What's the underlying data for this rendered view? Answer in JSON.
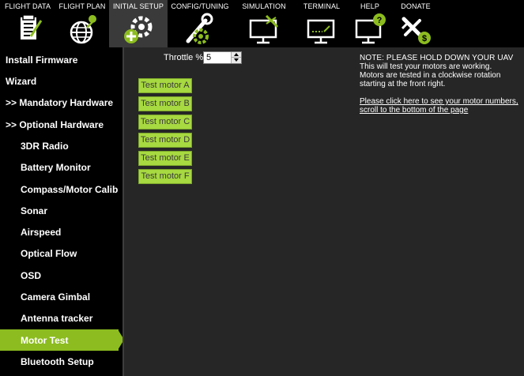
{
  "topnav": {
    "items": [
      {
        "label": "FLIGHT DATA",
        "icon": "clipboard-icon",
        "active": false
      },
      {
        "label": "FLIGHT PLAN",
        "icon": "globe-icon",
        "active": false
      },
      {
        "label": "INITIAL SETUP",
        "icon": "gear-plus-icon",
        "active": true
      },
      {
        "label": "CONFIG/TUNING",
        "icon": "wrench-gear-icon",
        "active": false
      },
      {
        "label": "SIMULATION",
        "icon": "monitor-plane-icon",
        "active": false
      },
      {
        "label": "TERMINAL",
        "icon": "terminal-monitor-icon",
        "active": false
      },
      {
        "label": "HELP",
        "icon": "help-monitor-icon",
        "active": false
      },
      {
        "label": "DONATE",
        "icon": "plane-dollar-icon",
        "active": false
      }
    ]
  },
  "sidebar": {
    "items": [
      {
        "label": "Install Firmware",
        "level": "top"
      },
      {
        "label": "Wizard",
        "level": "top"
      },
      {
        "label": ">> Mandatory Hardware",
        "level": "top"
      },
      {
        "label": ">> Optional Hardware",
        "level": "top"
      },
      {
        "label": "3DR Radio",
        "level": "sub"
      },
      {
        "label": "Battery Monitor",
        "level": "sub"
      },
      {
        "label": "Compass/Motor Calib",
        "level": "sub"
      },
      {
        "label": "Sonar",
        "level": "sub"
      },
      {
        "label": "Airspeed",
        "level": "sub"
      },
      {
        "label": "Optical Flow",
        "level": "sub"
      },
      {
        "label": "OSD",
        "level": "sub"
      },
      {
        "label": "Camera Gimbal",
        "level": "sub"
      },
      {
        "label": "Antenna tracker",
        "level": "sub"
      },
      {
        "label": "Motor Test",
        "level": "sub",
        "selected": true
      },
      {
        "label": "Bluetooth Setup",
        "level": "sub"
      }
    ]
  },
  "main": {
    "throttle_label": "Throttle %",
    "throttle_value": "5",
    "motor_buttons": [
      "Test motor A",
      "Test motor B",
      "Test motor C",
      "Test motor D",
      "Test motor E",
      "Test motor F"
    ],
    "note_title": "NOTE: PLEASE HOLD DOWN YOUR UAV",
    "note_line1": "This will test your motors are working.",
    "note_line2": "Motors are tested in a clockwise rotation",
    "note_line3": "starting at the front right.",
    "link_line1": "Please click here to see your motor numbers,",
    "link_line2": "scroll to the bottom of the page"
  },
  "colors": {
    "accent": "#8cbc1f",
    "button": "#a7d940",
    "background": "#262626",
    "sidebar": "#000000"
  }
}
